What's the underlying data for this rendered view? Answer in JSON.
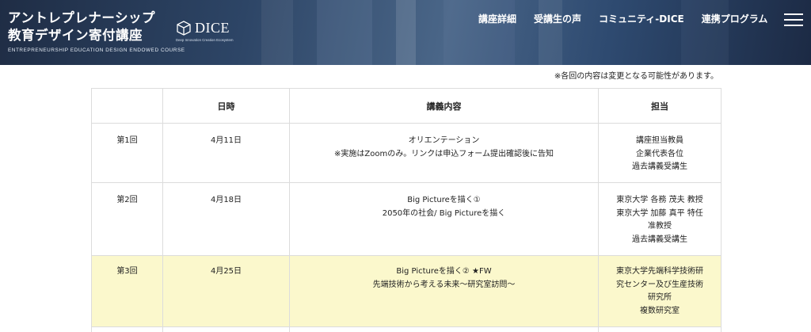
{
  "header": {
    "title_line1": "アントレプレナーシップ",
    "title_line2": "教育デザイン寄付講座",
    "subtitle": "ENTREPRENEURSHIP EDUCATION DESIGN ENDOWED COURSE",
    "logo_text": "DICE",
    "logo_tagline": "Deep Innovation Creation Ecosystem",
    "nav": [
      "講座詳細",
      "受講生の声",
      "コミュニティ-DICE",
      "連携プログラム"
    ]
  },
  "notice": "※各回の内容は変更となる可能性があります。",
  "table": {
    "headers": [
      "",
      "日時",
      "講義内容",
      "担当"
    ],
    "rows": [
      {
        "no": "第1回",
        "date": "4月11日",
        "content": [
          "オリエンテーション",
          "※実施はZoomのみ。リンクは申込フォーム提出確認後に告知"
        ],
        "lecturer": [
          "講座担当教員",
          "企業代表各位",
          "過去講義受講生"
        ]
      },
      {
        "no": "第2回",
        "date": "4月18日",
        "content": [
          "Big Pictureを描く①",
          "2050年の社会/ Big Pictureを描く"
        ],
        "lecturer": [
          "東京大学 各務 茂夫 教授",
          "東京大学 加藤 真平 特任",
          "准教授",
          "過去講義受講生"
        ]
      },
      {
        "no": "第3回",
        "date": "4月25日",
        "content": [
          "Big Pictureを描く② ★FW",
          "先端技術から考える未来〜研究室訪問〜"
        ],
        "lecturer": [
          "東京大学先端科学技術研",
          "究センター及び生産技術",
          "研究所",
          "複数研究室"
        ]
      }
    ]
  },
  "colors": {
    "header_bg": "#2d4566",
    "highlight_row": "#fbf8cc",
    "border": "#dcdcdc"
  }
}
